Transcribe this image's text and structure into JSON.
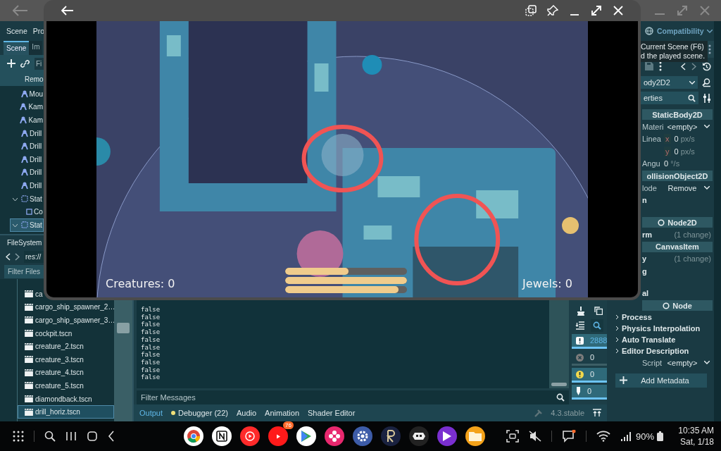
{
  "game_window": {
    "hud": {
      "creatures": "Creatures: 0",
      "jewels": "Jewels: 0",
      "bars": [
        {
          "level": 0.52
        },
        {
          "level": 1
        },
        {
          "level": 0.93
        }
      ]
    }
  },
  "editor": {
    "menu": [
      "Scene",
      "Pro"
    ],
    "scene_dock": {
      "tabs": [
        {
          "label": "Scene",
          "selected": true
        },
        {
          "label": "Im",
          "selected": false
        }
      ],
      "filter": "Fi",
      "remote": "Remo",
      "tree": [
        {
          "name": "Mou",
          "kind": "character",
          "selected": false
        },
        {
          "name": "Kam",
          "kind": "character",
          "selected": false
        },
        {
          "name": "Kam",
          "kind": "character",
          "selected": false
        },
        {
          "name": "Drill",
          "kind": "character",
          "selected": false
        },
        {
          "name": "Drill",
          "kind": "character",
          "selected": false
        },
        {
          "name": "Drill",
          "kind": "character",
          "selected": false
        },
        {
          "name": "Drill",
          "kind": "character",
          "selected": false
        },
        {
          "name": "Drill",
          "kind": "character",
          "selected": false
        },
        {
          "name": "Stat",
          "kind": "static",
          "selected": false,
          "expanded": true,
          "children": [
            {
              "name": "Co",
              "kind": "shape",
              "selected": false
            }
          ]
        },
        {
          "name": "Stat",
          "kind": "static",
          "selected": true,
          "expanded": true
        }
      ]
    },
    "filesystem": {
      "title": "FileSystem",
      "path": "res://",
      "filter": "Filter Files",
      "files": [
        {
          "name": "ca",
          "selected": false
        },
        {
          "name": "cargo_ship_spawner_2…",
          "selected": false
        },
        {
          "name": "cargo_ship_spawner_3…",
          "selected": false
        },
        {
          "name": "cockpit.tscn",
          "selected": false
        },
        {
          "name": "creature_2.tscn",
          "selected": false
        },
        {
          "name": "creature_3.tscn",
          "selected": false
        },
        {
          "name": "creature_4.tscn",
          "selected": false
        },
        {
          "name": "creature_5.tscn",
          "selected": false
        },
        {
          "name": "diamondback.tscn",
          "selected": false
        },
        {
          "name": "drill_horiz.tscn",
          "selected": true
        }
      ]
    },
    "output": {
      "lines": [
        "false",
        "false",
        "false",
        "false",
        "false",
        "false",
        "false",
        "false",
        "false",
        "false"
      ],
      "filter": "Filter Messages",
      "counters": [
        {
          "kind": "messages",
          "count": "2888",
          "selected": true
        },
        {
          "kind": "errors",
          "count": "0",
          "selected": false
        },
        {
          "kind": "warnings",
          "count": "0",
          "selected": true
        },
        {
          "kind": "editor",
          "count": "0",
          "selected": true
        }
      ]
    },
    "bottom_tabs": [
      {
        "label": "Output",
        "selected": true,
        "alert": false
      },
      {
        "label": "Debugger (22)",
        "selected": false,
        "alert": true
      },
      {
        "label": "Audio",
        "selected": false,
        "alert": false
      },
      {
        "label": "Animation",
        "selected": false,
        "alert": false
      },
      {
        "label": "Shader Editor",
        "selected": false,
        "alert": false
      }
    ],
    "version": "4.3.stable",
    "inspector": {
      "renderer": "Compatibility",
      "tooltip": [
        "Current Scene (F6)",
        "d the played scene."
      ],
      "node": "ody2D2",
      "filter": "erties",
      "rows": [
        {
          "kind": "header",
          "text": "StaticBody2D",
          "icon": false
        },
        {
          "kind": "prop",
          "label": "Materi",
          "value": "<empty>"
        },
        {
          "kind": "vector",
          "label": "Linea",
          "axis": "x",
          "value": "0",
          "unit": "px/s"
        },
        {
          "kind": "vector",
          "axis": "y",
          "value": "0",
          "unit": "px/s"
        },
        {
          "kind": "number",
          "label": "Angu",
          "value": "0",
          "unit": "°/s"
        },
        {
          "kind": "header",
          "text": "ollisionObject2D",
          "icon": false
        },
        {
          "kind": "prop",
          "label": "lode",
          "value": "Remove"
        },
        {
          "kind": "group",
          "label": "n"
        },
        {
          "kind": "spacer"
        },
        {
          "kind": "header",
          "text": "Node2D",
          "icon": true
        },
        {
          "kind": "group",
          "label": "rm",
          "note": "(1 change)"
        },
        {
          "kind": "header",
          "text": "CanvasItem",
          "icon": false
        },
        {
          "kind": "group",
          "label": "y",
          "note": "(1 change)"
        },
        {
          "kind": "group",
          "label": "g"
        },
        {
          "kind": "spacer"
        },
        {
          "kind": "group",
          "label": "al"
        },
        {
          "kind": "header",
          "text": "Node",
          "icon": true
        },
        {
          "kind": "section",
          "label": "Process"
        },
        {
          "kind": "section",
          "label": "Physics Interpolation"
        },
        {
          "kind": "section",
          "label": "Auto Translate"
        },
        {
          "kind": "section",
          "label": "Editor Description"
        },
        {
          "kind": "prop",
          "label": "Script",
          "value": "<empty>"
        },
        {
          "kind": "button",
          "label": "Add Metadata"
        }
      ]
    }
  },
  "taskbar": {
    "apps": [
      {
        "kind": "chrome"
      },
      {
        "kind": "notion"
      },
      {
        "kind": "music"
      },
      {
        "kind": "youtube",
        "badge": "76"
      },
      {
        "kind": "play"
      },
      {
        "kind": "flower"
      },
      {
        "kind": "settings"
      },
      {
        "kind": "rune"
      },
      {
        "kind": "invader"
      },
      {
        "kind": "video"
      },
      {
        "kind": "folder"
      }
    ],
    "battery": "90%",
    "time": "10:35 AM",
    "date": "Sat, 1/18"
  }
}
